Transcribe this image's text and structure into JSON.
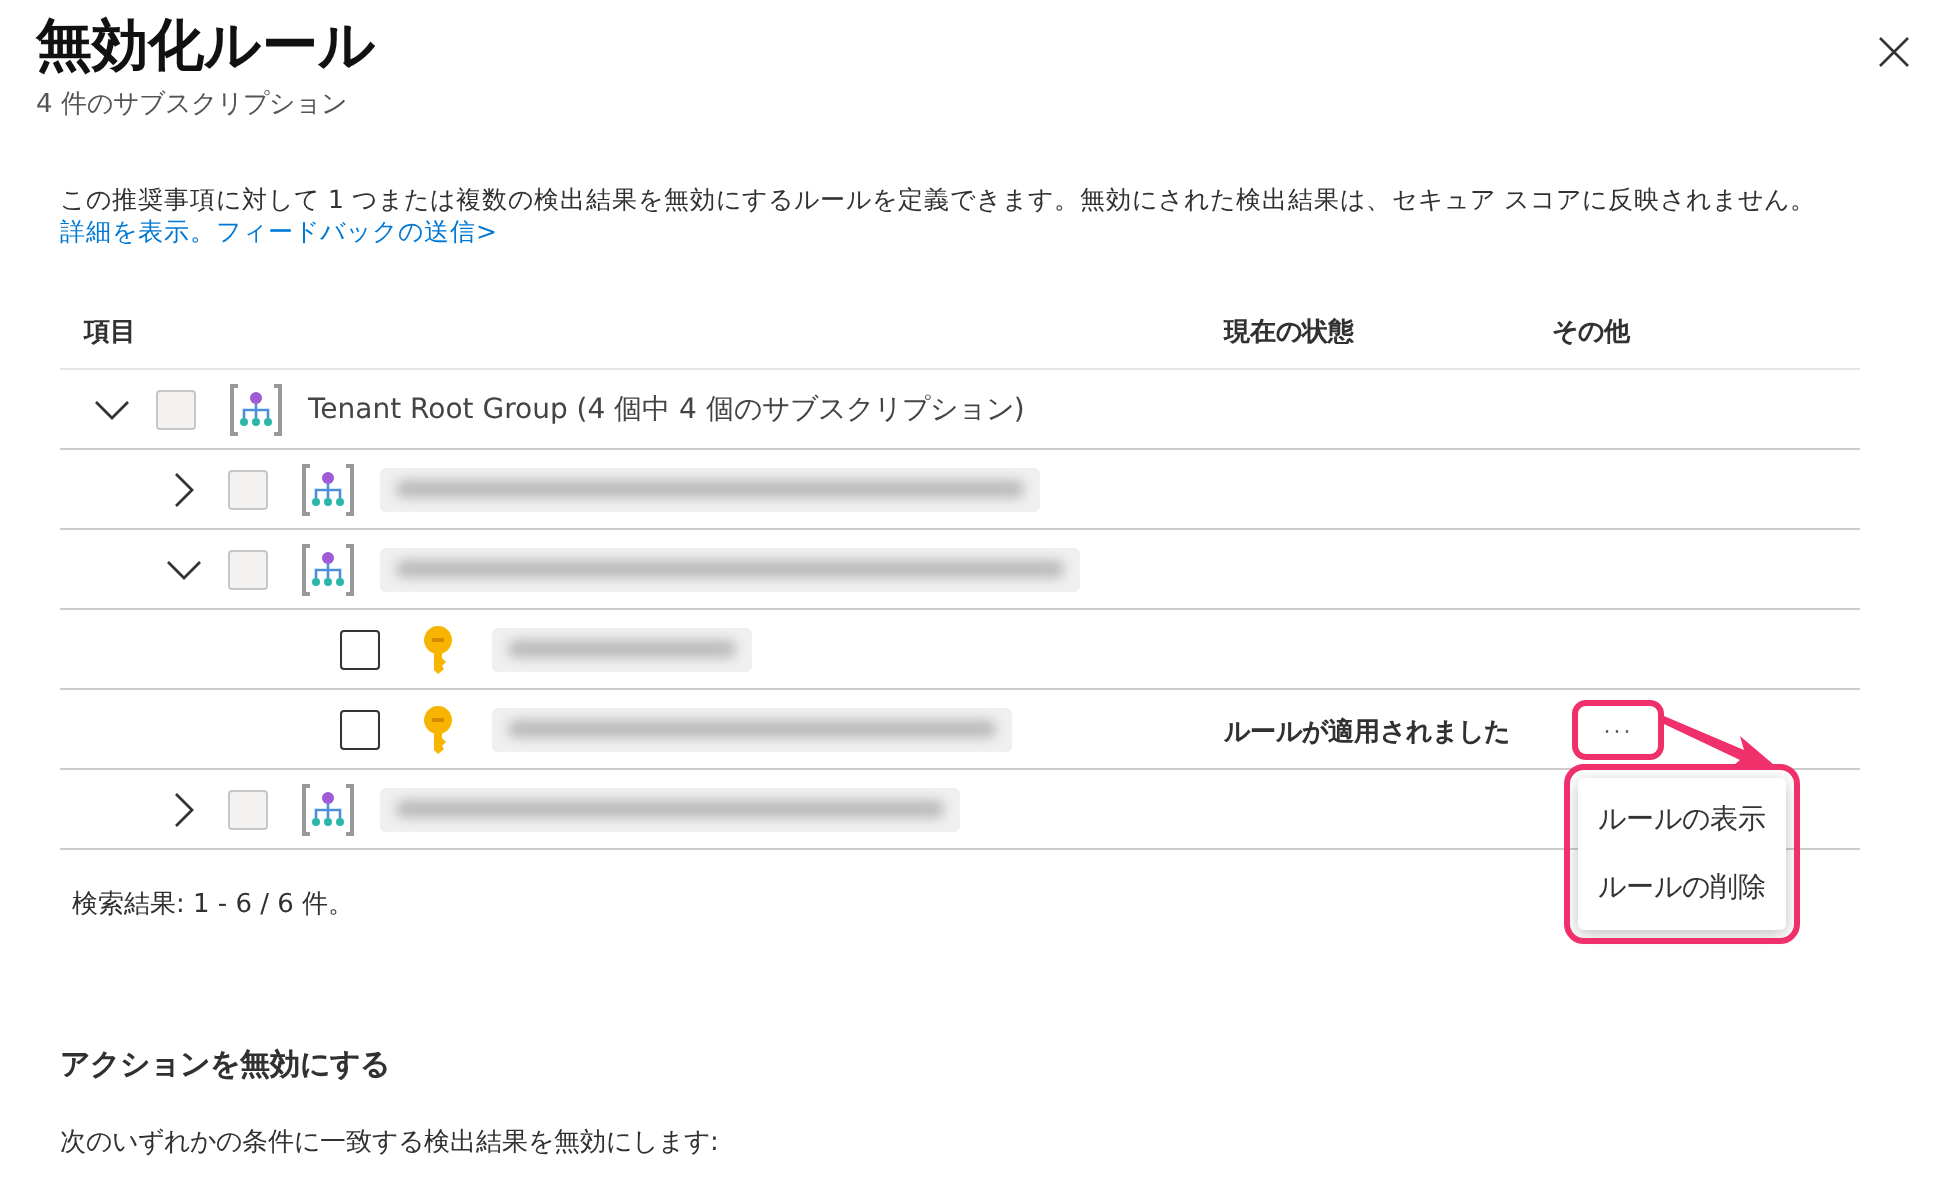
{
  "panel": {
    "title": "無効化ルール",
    "subtitle": "4 件のサブスクリプション",
    "description": "この推奨事項に対して 1 つまたは複数の検出結果を無効にするルールを定義できます。無効にされた検出結果は、セキュア スコアに反映されません。",
    "links": [
      "詳細を表示。",
      "フィードバックの送信>"
    ]
  },
  "table": {
    "columns": [
      "項目",
      "現在の状態",
      "その他"
    ],
    "rows": [
      {
        "kind": "group",
        "name": "Tenant Root Group (4 個中 4 個のサブスクリプション)",
        "redacted": false,
        "expanded": true,
        "disabled": true,
        "children": [
          {
            "kind": "group",
            "redacted": true,
            "expanded": false,
            "disabled": true
          },
          {
            "kind": "group",
            "redacted": true,
            "expanded": true,
            "disabled": true,
            "children": [
              {
                "kind": "subscription",
                "redacted": true,
                "disabled": false
              },
              {
                "kind": "subscription",
                "redacted": true,
                "disabled": false,
                "status": "ルールが適用されました",
                "more": {
                  "label": "···",
                  "highlighted": true
                },
                "menu": {
                  "highlighted": true,
                  "items": [
                    "ルールの表示",
                    "ルールの削除"
                  ]
                }
              }
            ]
          },
          {
            "kind": "group",
            "redacted": true,
            "expanded": false,
            "disabled": true
          }
        ]
      }
    ]
  },
  "results": "検索結果: 1 - 6 / 6 件。",
  "section": {
    "title": "アクションを無効にする",
    "text": "次のいずれかの条件に一致する検出結果を無効にします:"
  }
}
